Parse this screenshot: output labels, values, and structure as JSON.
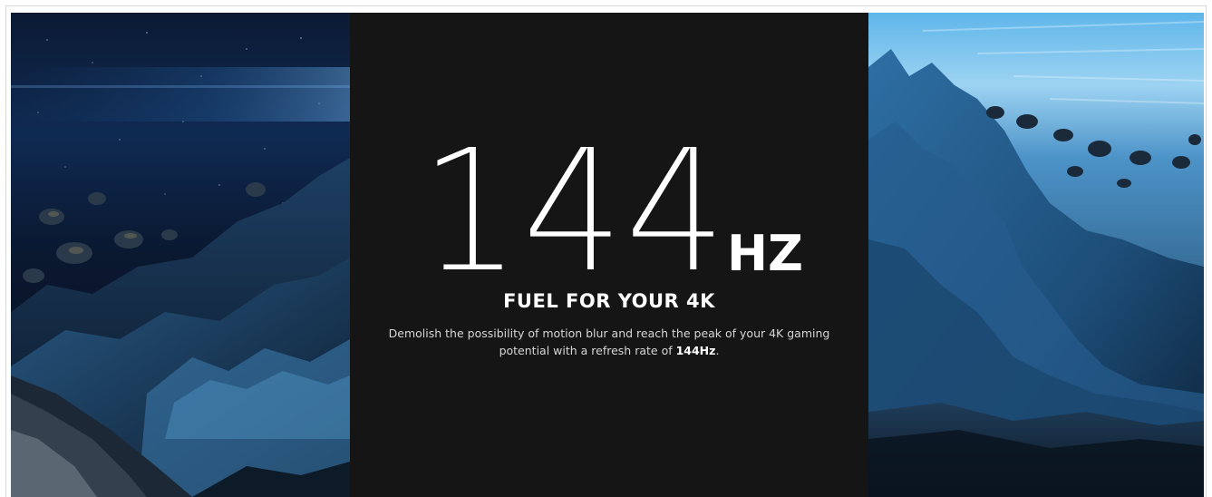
{
  "banner": {
    "refresh_number": "144",
    "refresh_unit": "HZ",
    "headline": "FUEL FOR YOUR 4K",
    "description_line1": "Demolish the possibility of motion blur and reach the peak of your 4K gaming",
    "description_line2_prefix": "potential with a refresh rate of ",
    "description_highlight": "144Hz",
    "description_suffix": "."
  },
  "colors": {
    "center_background": "#151515",
    "text": "#ffffff",
    "body_text": "#d6d6d6",
    "left_scene_accent": "#1f5f9f",
    "right_scene_accent": "#3a8fd0"
  }
}
